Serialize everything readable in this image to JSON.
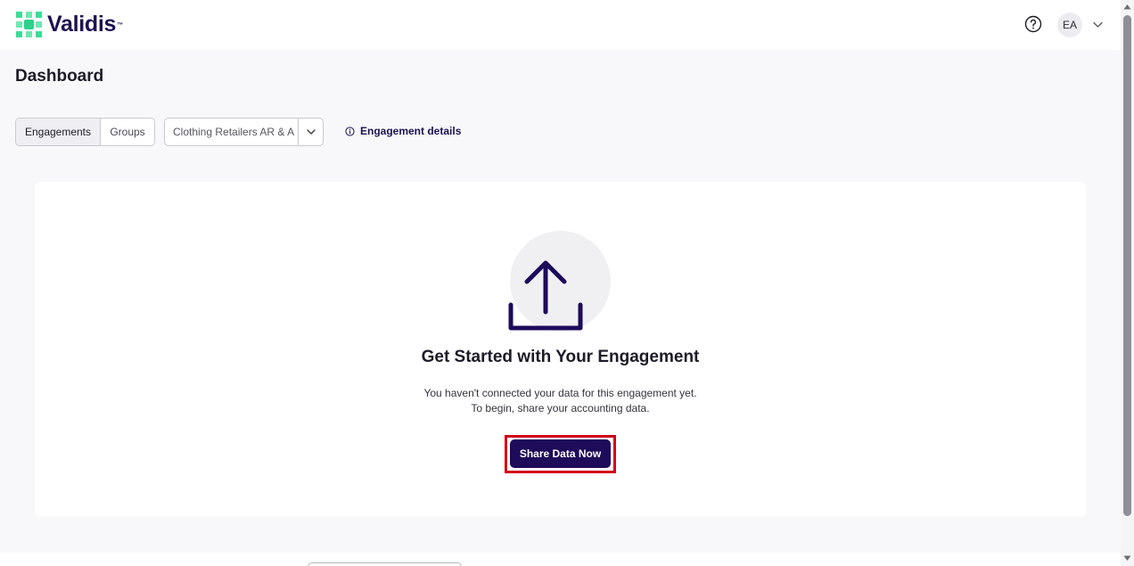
{
  "app": {
    "logo_text": "Validis",
    "logo_tm": "™"
  },
  "header": {
    "user_initials": "EA"
  },
  "page": {
    "title": "Dashboard"
  },
  "toolbar": {
    "segments": [
      {
        "label": "Engagements",
        "active": true
      },
      {
        "label": "Groups",
        "active": false
      }
    ],
    "engagement_select_value": "Clothing Retailers AR & A",
    "details_link_label": "Engagement details"
  },
  "empty_state": {
    "title": "Get Started with Your Engagement",
    "line1": "You haven't connected your data for this engagement yet.",
    "line2": "To begin, share your accounting data.",
    "cta_label": "Share Data Now"
  },
  "colors": {
    "brand_navy": "#1e0b5a",
    "logo_green": "#3ddc97",
    "highlight_red": "#d0021b"
  }
}
